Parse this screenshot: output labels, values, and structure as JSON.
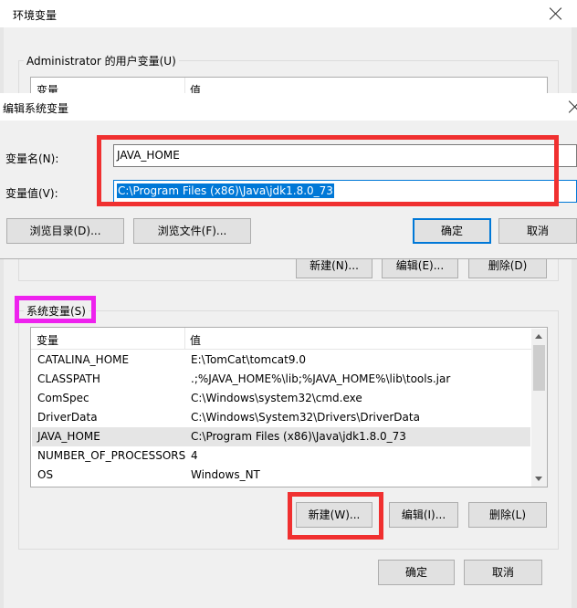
{
  "env_dialog": {
    "title": "环境变量",
    "user_group_label": "Administrator 的用户变量(U)",
    "user_col_var": "变量",
    "user_col_val": "值",
    "user_buttons": {
      "new": "新建(N)...",
      "edit": "编辑(E)...",
      "delete": "删除(D)"
    },
    "sys_group_label": "系统变量(S)",
    "sys_columns": {
      "var": "变量",
      "val": "值"
    },
    "sys_rows": [
      {
        "name": "CATALINA_HOME",
        "value": "E:\\TomCat\\tomcat9.0"
      },
      {
        "name": "CLASSPATH",
        "value": ".;%JAVA_HOME%\\lib;%JAVA_HOME%\\lib\\tools.jar"
      },
      {
        "name": "ComSpec",
        "value": "C:\\Windows\\system32\\cmd.exe"
      },
      {
        "name": "DriverData",
        "value": "C:\\Windows\\System32\\Drivers\\DriverData"
      },
      {
        "name": "JAVA_HOME",
        "value": "C:\\Program Files (x86)\\Java\\jdk1.8.0_73"
      },
      {
        "name": "NUMBER_OF_PROCESSORS",
        "value": "4"
      },
      {
        "name": "OS",
        "value": "Windows_NT"
      }
    ],
    "selected_row": "JAVA_HOME",
    "sys_buttons": {
      "new": "新建(W)...",
      "edit": "编辑(I)...",
      "delete": "删除(L)"
    },
    "ok": "确定",
    "cancel": "取消"
  },
  "edit_dialog": {
    "title": "编辑系统变量",
    "name_label": "变量名(N):",
    "name_value": "JAVA_HOME",
    "value_label": "变量值(V):",
    "value_value": "C:\\Program Files (x86)\\Java\\jdk1.8.0_73",
    "browse_dir": "浏览目录(D)...",
    "browse_file": "浏览文件(F)...",
    "ok": "确定",
    "cancel": "取消"
  },
  "colors": {
    "highlight_red": "#f03030",
    "highlight_magenta": "#ee22ee",
    "selection_blue": "#0078d7"
  }
}
